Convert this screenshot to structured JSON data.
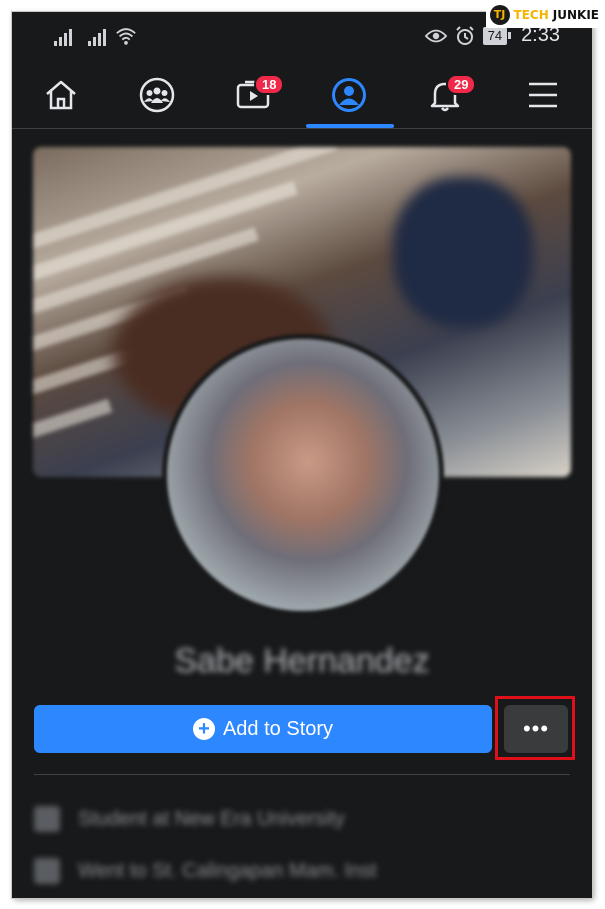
{
  "status_bar": {
    "battery": "74",
    "time": "2:33",
    "icons": [
      "signal-icon",
      "signal-icon",
      "wifi-icon",
      "eye-icon",
      "alarm-icon",
      "battery-icon"
    ]
  },
  "nav": {
    "items": [
      {
        "name": "home",
        "icon": "home-icon"
      },
      {
        "name": "groups",
        "icon": "groups-icon"
      },
      {
        "name": "watch",
        "icon": "video-icon",
        "badge": "18"
      },
      {
        "name": "profile",
        "icon": "profile-icon",
        "active": true
      },
      {
        "name": "notifications",
        "icon": "bell-icon",
        "badge": "29"
      },
      {
        "name": "menu",
        "icon": "hamburger-menu-icon"
      }
    ],
    "accent_color": "#2d88ff"
  },
  "profile": {
    "name": "Sabe Hernandez",
    "add_story_label": "Add to Story",
    "more_label": "•••",
    "info_rows": [
      "Student at New Era University",
      "Went to St. Calingapan Mam. Inst"
    ]
  },
  "watermark": {
    "logo": "TJ",
    "text_part1": "TECH",
    "text_part2": "JUNKIE"
  },
  "colors": {
    "background": "#18191a",
    "primary_button": "#2d88ff",
    "secondary_button": "#3a3b3c",
    "badge": "#f02849",
    "highlight": "#e0101a"
  }
}
